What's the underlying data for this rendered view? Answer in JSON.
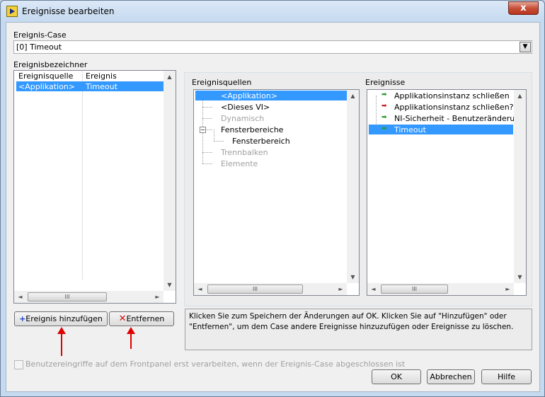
{
  "window": {
    "title": "Ereignisse bearbeiten",
    "close_symbol": "x"
  },
  "case": {
    "label": "Ereignis-Case",
    "value": "[0] Timeout",
    "arrow": "▼"
  },
  "bezeichner": {
    "label": "Ereignisbezeichner",
    "col_source": "Ereignisquelle",
    "col_event": "Ereignis",
    "rows": [
      {
        "source": "<Applikation>",
        "event": "Timeout"
      }
    ],
    "scroll_thumb": "III"
  },
  "quellen": {
    "label": "Ereignisquellen",
    "items": [
      "<Applikation>",
      "<Dieses VI>",
      "Dynamisch",
      "Fensterbereiche",
      "Fensterbereich",
      "Trennbalken",
      "Elemente"
    ],
    "expander": "−",
    "scroll_thumb": "III"
  },
  "ereignisse": {
    "label": "Ereignisse",
    "items": [
      "Applikationsinstanz schließen",
      "Applikationsinstanz schließen?",
      "NI-Sicherheit - Benutzeränderung",
      "Timeout"
    ],
    "arrow_colors": [
      "#2a9a2a",
      "#d02020",
      "#2a9a2a",
      "#2a9a2a"
    ],
    "arrow_glyph": "➡",
    "scroll_thumb": "III"
  },
  "buttons": {
    "add": "Ereignis hinzufügen",
    "add_icon": "+",
    "remove": "Entfernen",
    "remove_icon": "✕",
    "ok": "OK",
    "cancel": "Abbrechen",
    "help": "Hilfe"
  },
  "info_text": "Klicken Sie zum Speichern der Änderungen auf OK.  Klicken Sie auf \"Hinzufügen\" oder \"Entfernen\", um dem Case andere Ereignisse hinzuzufügen oder Ereignisse zu löschen.",
  "checkbox_label": "Benutzereingriffe auf dem Frontpanel erst verarbeiten, wenn der Ereignis-Case abgeschlossen ist",
  "scroll_glyphs": {
    "up": "▲",
    "down": "▼",
    "left": "◄",
    "right": "►"
  }
}
